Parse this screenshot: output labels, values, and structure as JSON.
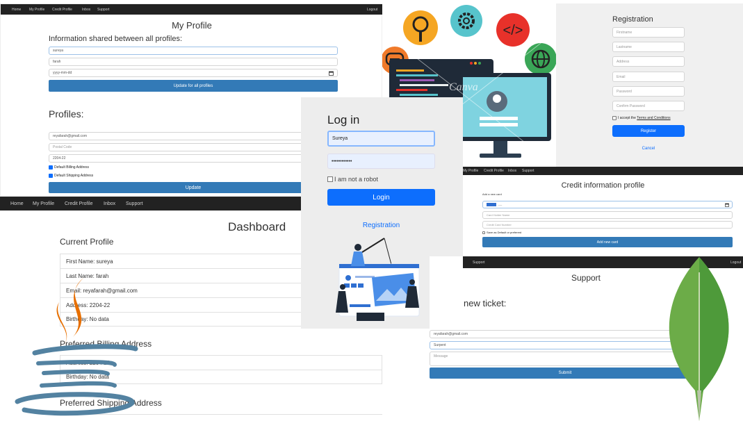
{
  "profile_page": {
    "nav": {
      "home": "Home",
      "my_profile": "My Profile",
      "credit_profile": "Credit Profile",
      "inbox": "Inbox",
      "support": "Support",
      "logout": "Logout"
    },
    "title": "My Profile",
    "shared_heading": "Information shared between all profiles:",
    "firstname_value": "sureya",
    "lastname_value": "farah",
    "date_placeholder": "yyyy-mm-dd",
    "update_all_label": "Update for all profiles",
    "profiles_heading": "Profiles:",
    "email_value": "reyafarah@gmail.com",
    "postal_placeholder": "Postal Code",
    "address_value": "2204-22",
    "billing_label": "Default Billing Address",
    "shipping_label": "Default Shipping Address",
    "update_label": "Update"
  },
  "registration": {
    "title": "Registration",
    "fields": [
      "Firstname",
      "Lastname",
      "Address",
      "Email",
      "Password",
      "Confirm Password"
    ],
    "terms_prefix": "I accept the",
    "terms_link": "Terms and Conditions",
    "register_label": "Register",
    "cancel_label": "Cancel"
  },
  "canva_label": "Canva",
  "dashboard": {
    "nav": {
      "home": "Home",
      "my_profile": "My Profile",
      "credit_profile": "Credit Profile",
      "inbox": "Inbox",
      "support": "Support"
    },
    "title": "Dashboard",
    "current_profile": "Current Profile",
    "rows": [
      "First Name: sureya",
      "Last Name: farah",
      "Email: reyafarah@gmail.com",
      "Address: 2204-22",
      "Birthday: No data"
    ],
    "billing_heading": "Preferred Billing Address",
    "billing_rows": [
      "Address: 2204-22",
      "Birthday: No data"
    ],
    "shipping_heading": "Preferred Shipping Address"
  },
  "login": {
    "title": "Log in",
    "username_value": "Sureya",
    "password_value": "••••••••••••",
    "robot_label": "I am not a robot",
    "login_label": "Login",
    "registration_link": "Registration"
  },
  "credit": {
    "nav": {
      "my_profile": "My Profile",
      "credit_profile": "Credit Profile",
      "inbox": "Inbox",
      "support": "Support"
    },
    "title": "Credit information profile",
    "add_new_card": "Add a new card",
    "date_placeholder": "----",
    "holder_placeholder": "Card Holder Name",
    "number_placeholder": "Credit Card Number",
    "default_label": "Save as Default or preferred",
    "add_button": "Add new card"
  },
  "support": {
    "nav": {
      "support": "Support",
      "logout": "Logout"
    },
    "title": "Support",
    "new_ticket": "new ticket:",
    "email_value": "reyafarah@gmail.com",
    "subject_value": "Surpent",
    "message_placeholder": "Message",
    "submit_label": "Submit"
  },
  "colors": {
    "navbar": "#222222",
    "bootstrap_blue": "#337ab7",
    "login_blue": "#0d6efd",
    "java_orange": "#e76f00",
    "java_blue": "#5382a1",
    "mongo_green": "#6cac48"
  },
  "icons": [
    "magnifier-icon",
    "gear-icon",
    "code-icon",
    "chat-icon",
    "globe-icon",
    "user-avatar-icon",
    "java-logo",
    "mongodb-leaf-logo"
  ]
}
